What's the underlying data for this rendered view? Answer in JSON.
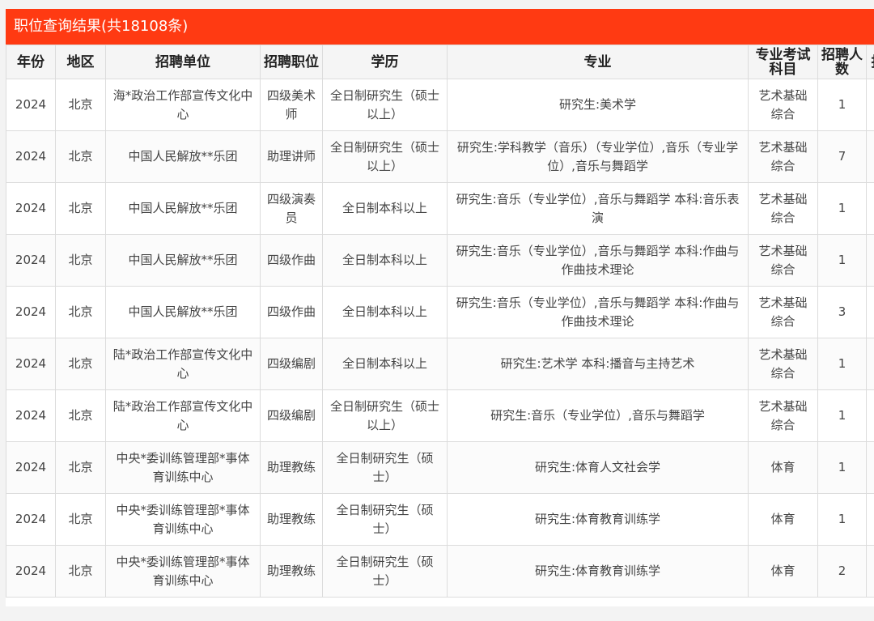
{
  "title": "职位查询结果(共18108条)",
  "columns": [
    "年份",
    "地区",
    "招聘单位",
    "招聘职位",
    "学历",
    "专业",
    "专业考试科目",
    "招聘人数",
    "报"
  ],
  "rows": [
    [
      "2024",
      "北京",
      "海*政治工作部宣传文化中心",
      "四级美术师",
      "全日制研究生（硕士以上）",
      "研究生:美术学",
      "艺术基础综合",
      "1",
      ""
    ],
    [
      "2024",
      "北京",
      "中国人民解放**乐团",
      "助理讲师",
      "全日制研究生（硕士以上）",
      "研究生:学科教学（音乐）（专业学位）,音乐（专业学位）,音乐与舞蹈学",
      "艺术基础综合",
      "7",
      ""
    ],
    [
      "2024",
      "北京",
      "中国人民解放**乐团",
      "四级演奏员",
      "全日制本科以上",
      "研究生:音乐（专业学位）,音乐与舞蹈学 本科:音乐表演",
      "艺术基础综合",
      "1",
      ""
    ],
    [
      "2024",
      "北京",
      "中国人民解放**乐团",
      "四级作曲",
      "全日制本科以上",
      "研究生:音乐（专业学位）,音乐与舞蹈学 本科:作曲与作曲技术理论",
      "艺术基础综合",
      "1",
      ""
    ],
    [
      "2024",
      "北京",
      "中国人民解放**乐团",
      "四级作曲",
      "全日制本科以上",
      "研究生:音乐（专业学位）,音乐与舞蹈学 本科:作曲与作曲技术理论",
      "艺术基础综合",
      "3",
      ""
    ],
    [
      "2024",
      "北京",
      "陆*政治工作部宣传文化中心",
      "四级编剧",
      "全日制本科以上",
      "研究生:艺术学 本科:播音与主持艺术",
      "艺术基础综合",
      "1",
      ""
    ],
    [
      "2024",
      "北京",
      "陆*政治工作部宣传文化中心",
      "四级编剧",
      "全日制研究生（硕士以上）",
      "研究生:音乐（专业学位）,音乐与舞蹈学",
      "艺术基础综合",
      "1",
      ""
    ],
    [
      "2024",
      "北京",
      "中央*委训练管理部*事体育训练中心",
      "助理教练",
      "全日制研究生（硕士）",
      "研究生:体育人文社会学",
      "体育",
      "1",
      ""
    ],
    [
      "2024",
      "北京",
      "中央*委训练管理部*事体育训练中心",
      "助理教练",
      "全日制研究生（硕士）",
      "研究生:体育教育训练学",
      "体育",
      "1",
      ""
    ],
    [
      "2024",
      "北京",
      "中央*委训练管理部*事体育训练中心",
      "助理教练",
      "全日制研究生（硕士）",
      "研究生:体育教育训练学",
      "体育",
      "2",
      ""
    ]
  ]
}
